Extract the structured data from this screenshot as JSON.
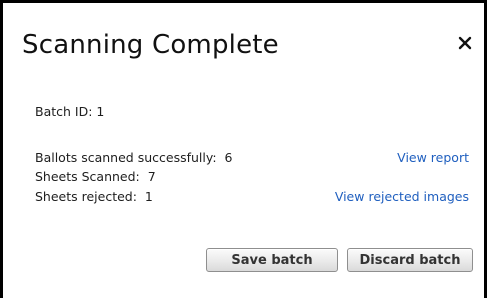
{
  "dialog": {
    "title": "Scanning Complete",
    "close_icon": "close-icon"
  },
  "batch": {
    "id_text": "Batch ID: 1"
  },
  "summary": {
    "ballots_scanned": "Ballots scanned successfully:  6",
    "sheets_scanned": "Sheets Scanned:  7",
    "sheets_rejected": "Sheets rejected:  1",
    "view_report_link": "View report",
    "view_rejected_link": "View rejected images"
  },
  "actions": {
    "save_label": "Save batch",
    "discard_label": "Discard batch"
  },
  "colors": {
    "link": "#1f5fbf",
    "border": "#000000"
  }
}
